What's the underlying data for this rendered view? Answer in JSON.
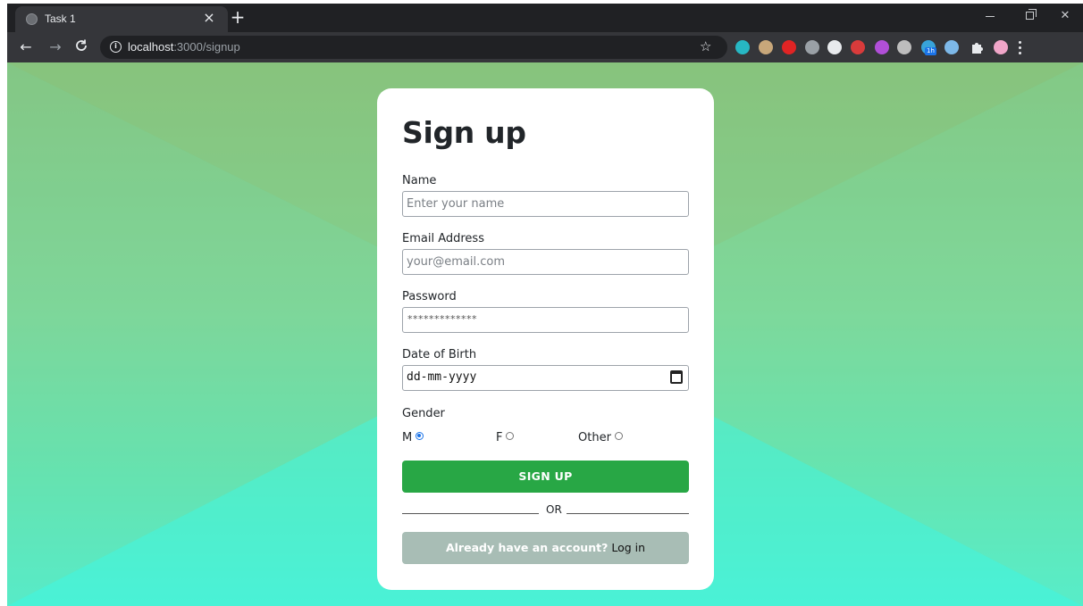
{
  "browser": {
    "tab_title": "Task 1",
    "tab_close": "×",
    "new_tab": "+",
    "url_host": "localhost",
    "url_path": ":3000/signup",
    "info_glyph": "i",
    "nav": {
      "back": "←",
      "forward": "→",
      "reload": "C"
    },
    "star": "☆",
    "extensions": [
      {
        "name": "extension-m-icon",
        "color": "#27b7c3"
      },
      {
        "name": "extension-glasses-icon",
        "color": "#c8a77a"
      },
      {
        "name": "extension-hand-icon",
        "color": "#e02424"
      },
      {
        "name": "extension-bottle-icon",
        "color": "#9aa0a6"
      },
      {
        "name": "extension-paint-icon",
        "color": "#e8eaed"
      },
      {
        "name": "extension-red-icon",
        "color": "#d93b3b"
      },
      {
        "name": "extension-purple-icon",
        "color": "#b14fd8"
      },
      {
        "name": "extension-target-icon",
        "color": "#bdbdbd"
      },
      {
        "name": "extension-cloud-icon",
        "color": "#38a3d9"
      },
      {
        "name": "extension-moon-icon",
        "color": "#7db8e8"
      },
      {
        "name": "extensions-puzzle-icon",
        "color": "#e8eaed"
      },
      {
        "name": "profile-avatar-icon",
        "color": "#f0a6c8"
      },
      {
        "name": "menu-kebab-icon",
        "color": "#e8eaed"
      }
    ],
    "ext_badge": "1h"
  },
  "form": {
    "title": "Sign up",
    "name_label": "Name",
    "name_placeholder": "Enter your name",
    "email_label": "Email Address",
    "email_placeholder": "your@email.com",
    "password_label": "Password",
    "password_value": "*************",
    "dob_label": "Date of Birth",
    "dob_value": "dd-mm-yyyy",
    "gender_label": "Gender",
    "gender_options": [
      "M",
      "F",
      "Other"
    ],
    "gender_selected": "M",
    "signup_button": "SIGN UP",
    "or_text": "OR",
    "login_prompt": "Already have an account?",
    "login_link": "Log in"
  },
  "colors": {
    "primary_button": "#28a745",
    "secondary_button": "#a8bdb5",
    "radio_accent": "#1a73e8"
  }
}
